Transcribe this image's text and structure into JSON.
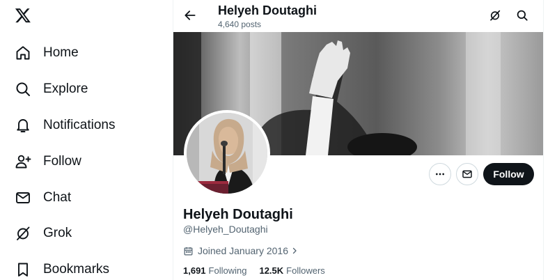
{
  "nav": {
    "items": [
      {
        "label": "Home",
        "icon": "home-icon"
      },
      {
        "label": "Explore",
        "icon": "search-icon"
      },
      {
        "label": "Notifications",
        "icon": "bell-icon"
      },
      {
        "label": "Follow",
        "icon": "person-add-icon"
      },
      {
        "label": "Chat",
        "icon": "envelope-icon"
      },
      {
        "label": "Grok",
        "icon": "grok-icon"
      },
      {
        "label": "Bookmarks",
        "icon": "bookmark-icon"
      }
    ]
  },
  "header": {
    "name": "Helyeh Doutaghi",
    "posts": "4,640 posts"
  },
  "profile": {
    "name": "Helyeh Doutaghi",
    "handle": "@Helyeh_Doutaghi",
    "joined": "Joined January 2016",
    "follow_label": "Follow",
    "following_count": "1,691",
    "following_label": "Following",
    "followers_count": "12.5K",
    "followers_label": "Followers"
  },
  "colors": {
    "text": "#0f1419",
    "secondary": "#536471",
    "border": "#cfd9de",
    "follow_bg": "#0f1419"
  }
}
